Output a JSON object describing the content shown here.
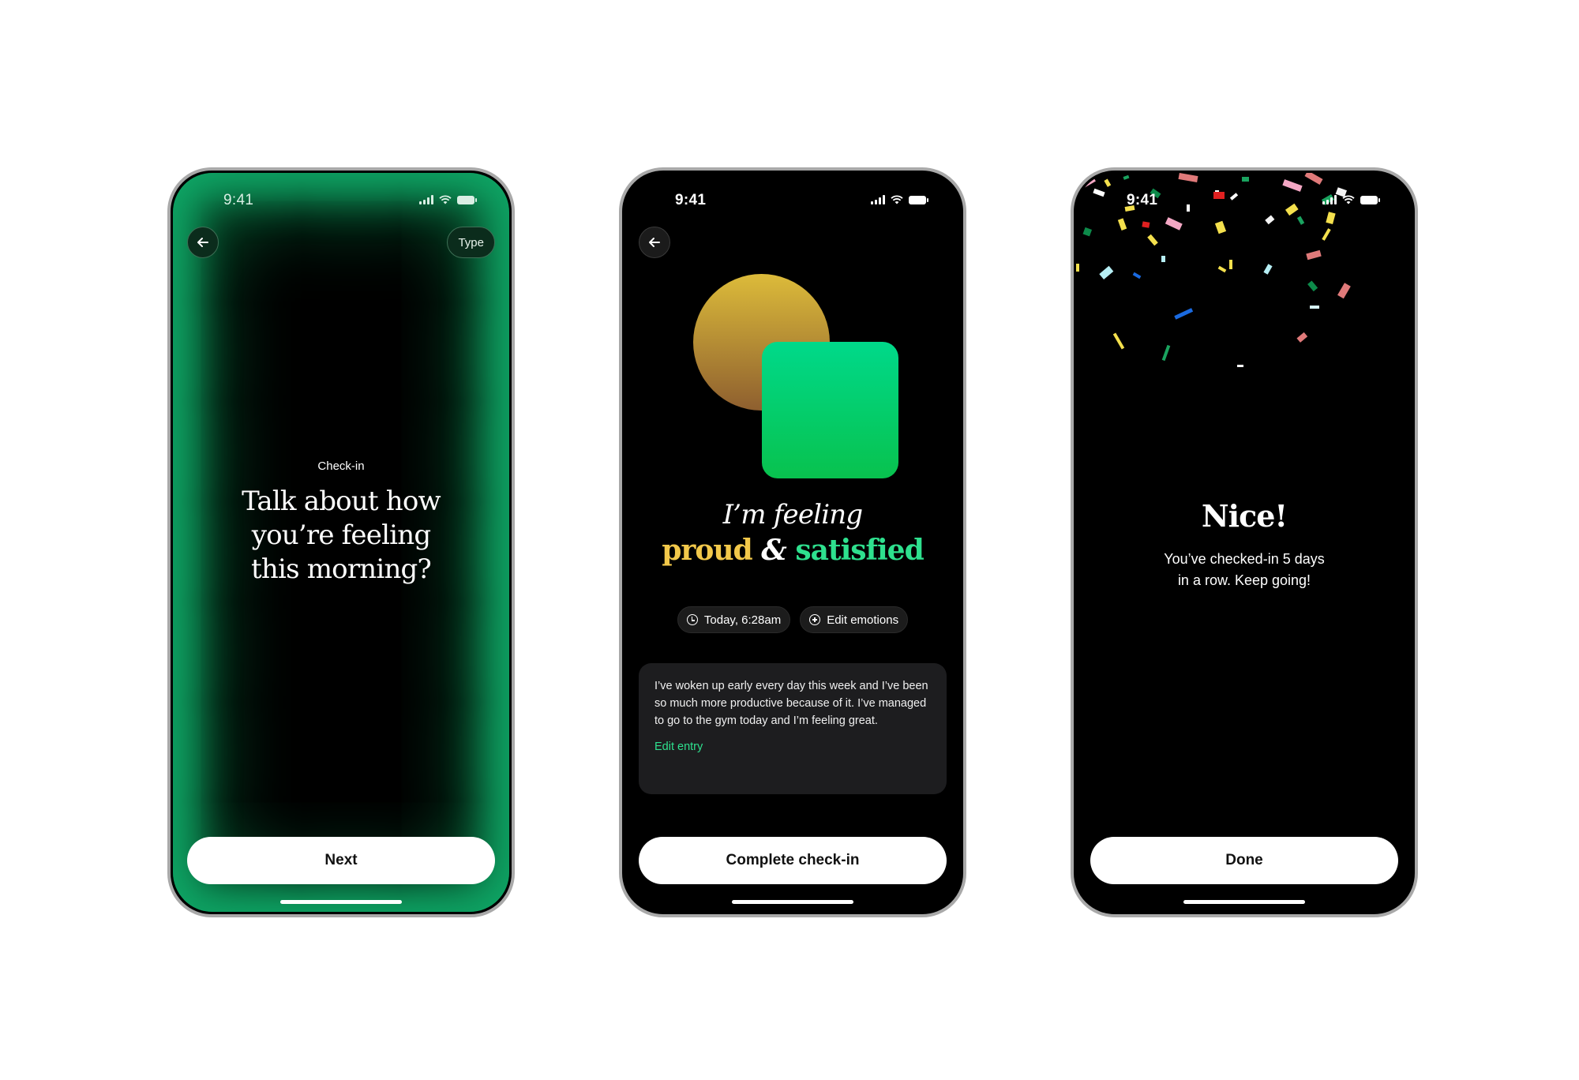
{
  "screens": [
    {
      "status": {
        "time": "9:41"
      },
      "type_button": "Type",
      "label": "Check-in",
      "title_lines": [
        "Talk about how",
        "you’re feeling",
        "this morning?"
      ],
      "primary_button": "Next"
    },
    {
      "status": {
        "time": "9:41"
      },
      "feeling": {
        "prefix": "I’m feeling",
        "emotion_a": "proud",
        "connector": "&",
        "emotion_b": "satisfied"
      },
      "chips": {
        "time": "Today, 6:28am",
        "edit_emotions": "Edit emotions"
      },
      "entry": {
        "text": "I’ve woken up early every day this week and I’ve been so much more productive because of it. I’ve managed to go to the gym today and I’m feeling great.",
        "edit_link": "Edit entry"
      },
      "primary_button": "Complete check-in"
    },
    {
      "status": {
        "time": "9:41"
      },
      "title": "Nice!",
      "subtitle_lines": [
        "You’ve checked-in 5 days",
        "in a row. Keep going!"
      ],
      "primary_button": "Done"
    }
  ],
  "icons": {
    "back": "arrow-left-icon",
    "signal": "cellular-signal-icon",
    "wifi": "wifi-icon",
    "battery": "battery-icon",
    "clock": "clock-icon",
    "add": "plus-circle-icon"
  },
  "colors": {
    "glow_green": "#0fa565",
    "accent_gold": "#f2c84a",
    "accent_green": "#2ee08e",
    "card_bg": "#1d1d1f"
  }
}
